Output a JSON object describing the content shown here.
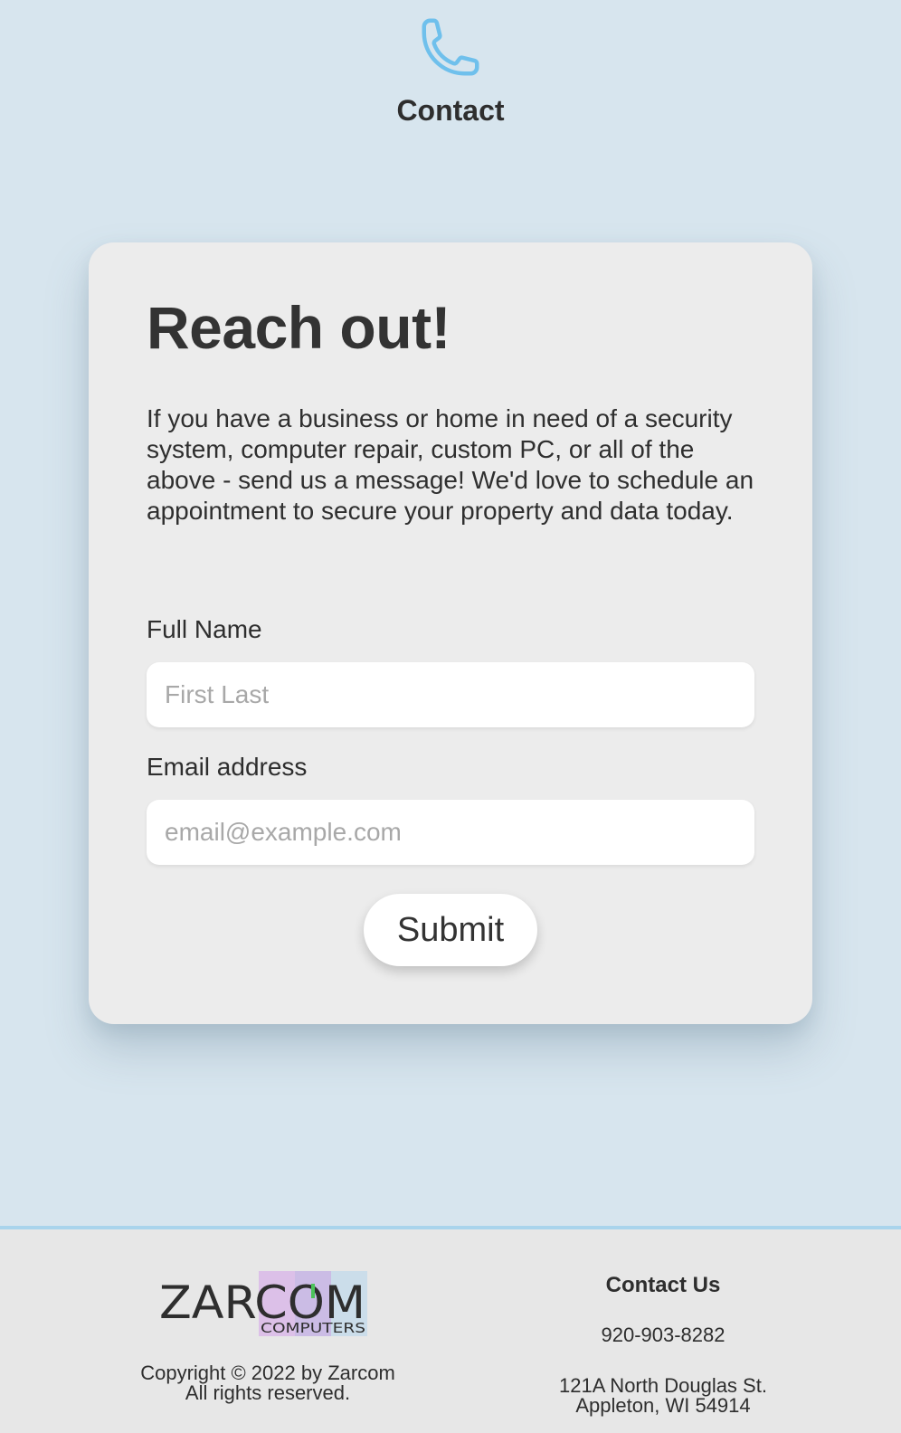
{
  "header": {
    "icon": "phone-icon",
    "title": "Contact",
    "accent_color": "#6fc0ec"
  },
  "card": {
    "title": "Reach out!",
    "description": "If you have a business or home in need of a security system, computer repair, custom PC, or all of the above - send us a message! We'd love to schedule an appointment to secure your property and data today.",
    "fields": {
      "name": {
        "label": "Full Name",
        "value": "",
        "placeholder": "First Last"
      },
      "email": {
        "label": "Email address",
        "value": "",
        "placeholder": "email@example.com"
      }
    },
    "submit_label": "Submit"
  },
  "footer": {
    "logo": {
      "main_text": "ZARCOM",
      "sub_text": "COMPUTERS"
    },
    "copyright_line1": "Copyright © 2022 by Zarcom",
    "copyright_line2": "All rights reserved.",
    "contact_heading": "Contact Us",
    "phone": "920-903-8282",
    "address_line1": "121A North Douglas St.",
    "address_line2": "Appleton, WI 54914"
  }
}
